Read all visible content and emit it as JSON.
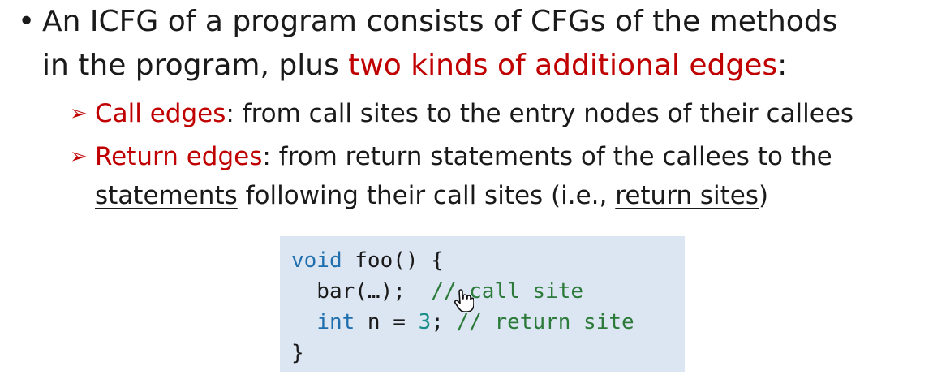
{
  "bullet1": {
    "line1": "An ICFG of a program consists of CFGs of the methods",
    "line2_prefix": "in the program, plus ",
    "line2_highlight": "two kinds of additional edges",
    "line2_suffix": ":"
  },
  "sub1": {
    "term": "Call edges",
    "rest": ": from call sites to the entry nodes of their callees"
  },
  "sub2": {
    "term": "Return edges",
    "rest1": ": from return statements of the callees to the",
    "underline1": "statements",
    "middle": " following their call sites (i.e., ",
    "underline2": "return sites",
    "end": ")"
  },
  "code": {
    "l1_kw": "void",
    "l1_rest": " foo() {",
    "l2_code": "  bar(…);  ",
    "l2_comment": "// call site",
    "l3_kw": "int",
    "l3_mid": " n = ",
    "l3_num": "3",
    "l3_semi": ";",
    "l3_comment": " // return site",
    "l4": "}"
  },
  "colors": {
    "highlight_red": "#c00000",
    "code_bg": "#dce6f2",
    "keyword": "#1f6fae",
    "comment": "#2b7a3a"
  },
  "icons": {
    "bullet": "•",
    "sub_bullet": "➢",
    "cursor": "hand-pointer-icon"
  }
}
